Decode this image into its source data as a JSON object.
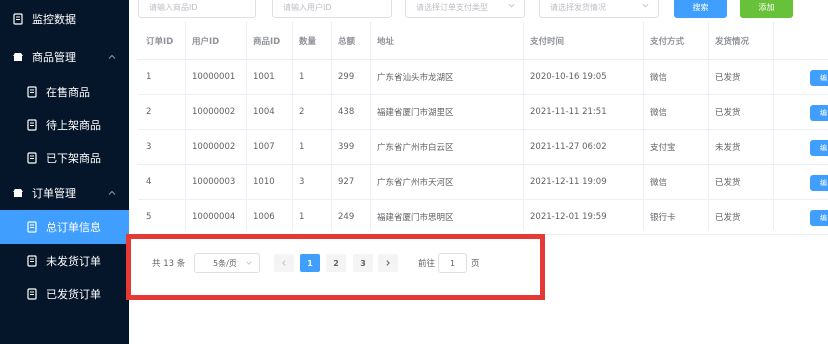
{
  "sidebar": {
    "items": [
      {
        "label": "监控数据",
        "icon": "document-icon",
        "level": "top"
      },
      {
        "label": "商品管理",
        "icon": "shop-icon",
        "level": "top",
        "expanded": true
      },
      {
        "label": "在售商品",
        "icon": "document-icon",
        "level": "sub"
      },
      {
        "label": "待上架商品",
        "icon": "document-icon",
        "level": "sub"
      },
      {
        "label": "已下架商品",
        "icon": "document-icon",
        "level": "sub"
      },
      {
        "label": "订单管理",
        "icon": "shop-icon",
        "level": "top",
        "expanded": true
      },
      {
        "label": "总订单信息",
        "icon": "document-icon",
        "level": "sub",
        "active": true
      },
      {
        "label": "未发货订单",
        "icon": "document-icon",
        "level": "sub"
      },
      {
        "label": "已发货订单",
        "icon": "document-icon",
        "level": "sub"
      }
    ]
  },
  "toolbar": {
    "product_id_placeholder": "请输入商品ID",
    "user_id_placeholder": "请输入用户ID",
    "pay_type_placeholder": "请选择订单支付类型",
    "ship_status_placeholder": "请选择发货情况",
    "search_label": "搜索",
    "add_label": "添加"
  },
  "table": {
    "columns": [
      "订单ID",
      "用户ID",
      "商品ID",
      "数量",
      "总额",
      "地址",
      "支付时间",
      "支付方式",
      "发货情况"
    ],
    "rows": [
      {
        "order_id": "1",
        "user_id": "10000001",
        "product_id": "1001",
        "qty": "1",
        "total": "299",
        "address": "广东省汕头市龙湖区",
        "pay_time": "2020-10-16 19:05",
        "pay_method": "微信",
        "ship": "已发货",
        "action": "编"
      },
      {
        "order_id": "2",
        "user_id": "10000002",
        "product_id": "1004",
        "qty": "2",
        "total": "438",
        "address": "福建省厦门市湖里区",
        "pay_time": "2021-11-11 21:51",
        "pay_method": "微信",
        "ship": "已发货",
        "action": "编"
      },
      {
        "order_id": "3",
        "user_id": "10000002",
        "product_id": "1007",
        "qty": "1",
        "total": "399",
        "address": "广东省广州市白云区",
        "pay_time": "2021-11-27 06:02",
        "pay_method": "支付宝",
        "ship": "未发货",
        "action": "编"
      },
      {
        "order_id": "4",
        "user_id": "10000003",
        "product_id": "1010",
        "qty": "3",
        "total": "927",
        "address": "广东省广州市天河区",
        "pay_time": "2021-12-11 19:09",
        "pay_method": "微信",
        "ship": "已发货",
        "action": "编"
      },
      {
        "order_id": "5",
        "user_id": "10000004",
        "product_id": "1006",
        "qty": "1",
        "total": "249",
        "address": "福建省厦门市思明区",
        "pay_time": "2021-12-01 19:59",
        "pay_method": "银行卡",
        "ship": "已发货",
        "action": "编"
      }
    ]
  },
  "pagination": {
    "total_text": "共 13 条",
    "page_size": "5条/页",
    "pages": [
      "1",
      "2",
      "3"
    ],
    "current_page": "1",
    "goto_label": "前往",
    "goto_value": "1",
    "page_unit": "页"
  },
  "colors": {
    "sidebar_bg": "#05162a",
    "accent": "#409eff",
    "add_button": "#67c23a",
    "highlight_border": "#e53935"
  }
}
